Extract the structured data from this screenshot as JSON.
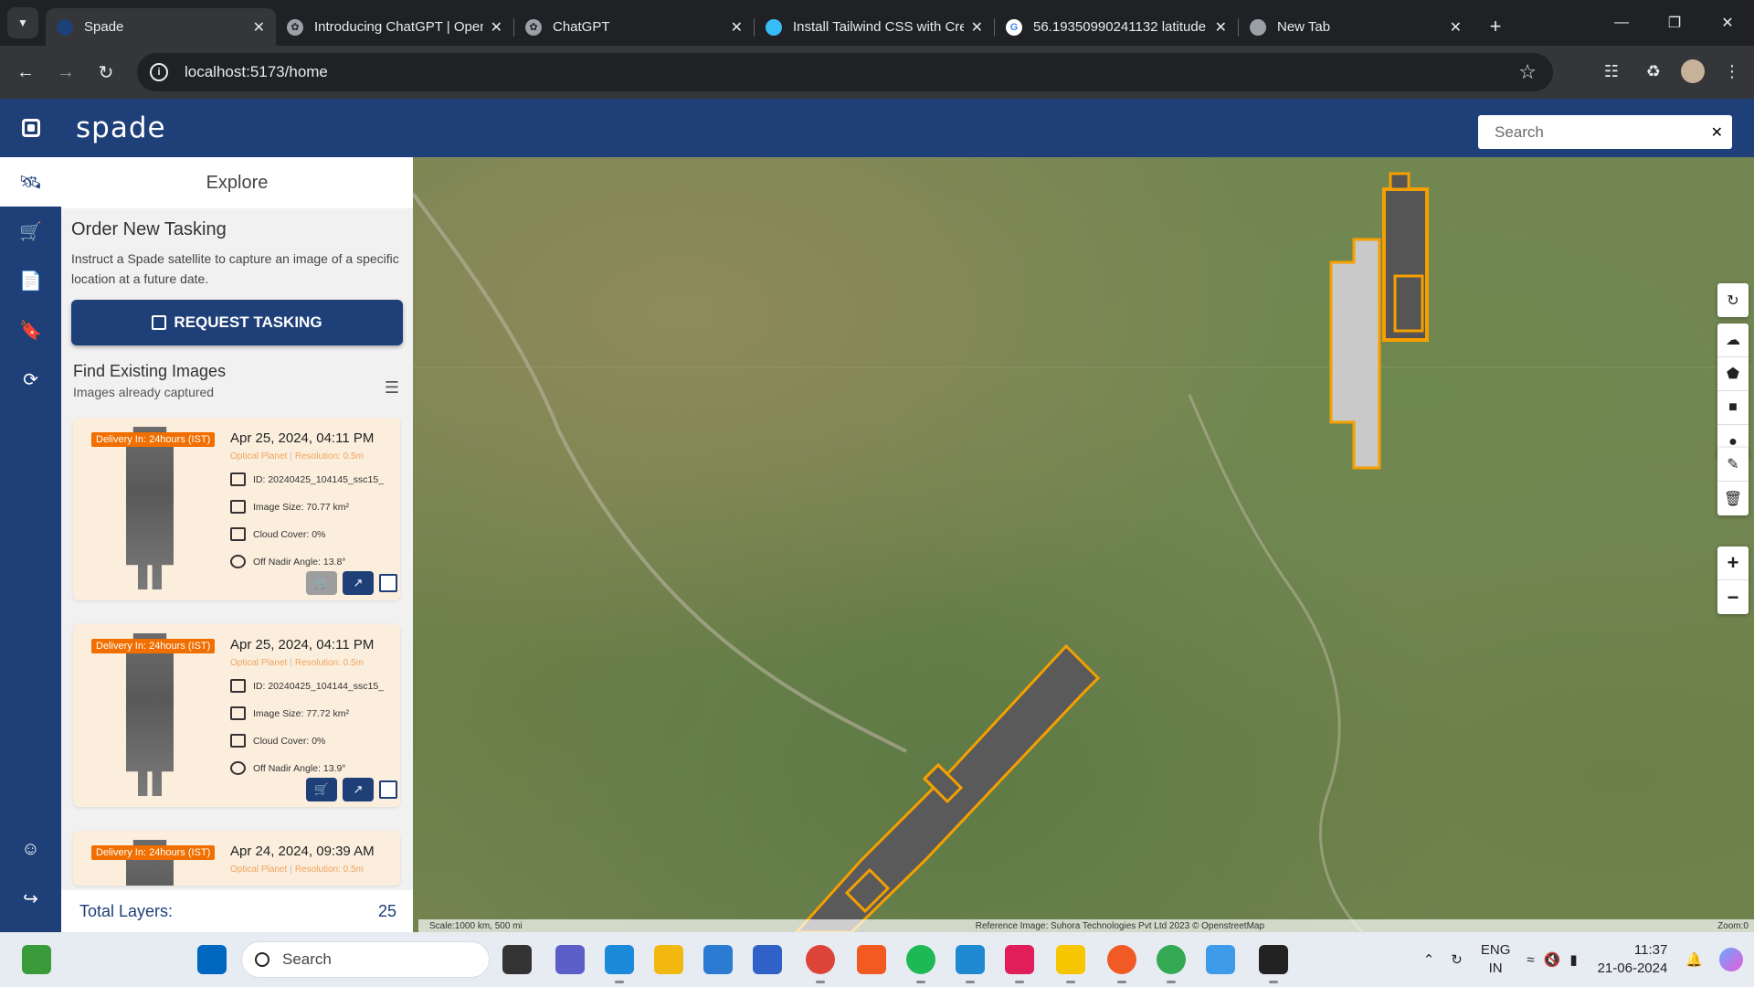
{
  "browser": {
    "tabs": [
      {
        "title": "Spade",
        "active": true
      },
      {
        "title": "Introducing ChatGPT | OpenAI",
        "active": false
      },
      {
        "title": "ChatGPT",
        "active": false
      },
      {
        "title": "Install Tailwind CSS with Create React App",
        "active": false
      },
      {
        "title": "56.19350990241132 latitude",
        "active": false
      },
      {
        "title": "New Tab",
        "active": false
      }
    ],
    "url": "localhost:5173/home"
  },
  "app": {
    "brand": "spade",
    "search_placeholder": "Search",
    "panel_title": "Explore",
    "order": {
      "heading": "Order New Tasking",
      "description": "Instruct a Spade satellite to capture an image of a specific location at a future date.",
      "button": "REQUEST TASKING"
    },
    "find": {
      "heading": "Find Existing Images",
      "subheading": "Images already captured"
    },
    "cards": [
      {
        "badge": "Delivery In: 24hours (IST)",
        "date": "Apr 25, 2024, 04:11 PM",
        "type": "Optical Planet",
        "resolution": "Resolution: 0.5m",
        "id": "ID: 20240425_104145_ssc15_",
        "size": "Image Size: 70.77 km²",
        "cloud": "Cloud Cover: 0%",
        "nadir": "Off Nadir Angle: 13.8°",
        "cart_disabled": true
      },
      {
        "badge": "Delivery In: 24hours (IST)",
        "date": "Apr 25, 2024, 04:11 PM",
        "type": "Optical Planet",
        "resolution": "Resolution: 0.5m",
        "id": "ID: 20240425_104144_ssc15_",
        "size": "Image Size: 77.72 km²",
        "cloud": "Cloud Cover: 0%",
        "nadir": "Off Nadir Angle: 13.9°",
        "cart_disabled": false
      },
      {
        "badge": "Delivery In: 24hours (IST)",
        "date": "Apr 24, 2024, 09:39 AM",
        "type": "Optical Planet",
        "resolution": "Resolution: 0.5m"
      }
    ],
    "total_label": "Total Layers:",
    "total_value": "25",
    "map": {
      "scale": "Scale:1000 km, 500 mi",
      "reference": "Reference Image: Suhora Technologies Pvt Ltd 2023 © OpenstreetMap",
      "zoom": "Zoom:0"
    }
  },
  "taskbar": {
    "search": "Search",
    "lang1": "ENG",
    "lang2": "IN",
    "time": "11:37",
    "date": "21-06-2024"
  },
  "colors": {
    "accent": "#1e3f78",
    "footprint": "#f5a000",
    "badge": "#f06f00"
  }
}
